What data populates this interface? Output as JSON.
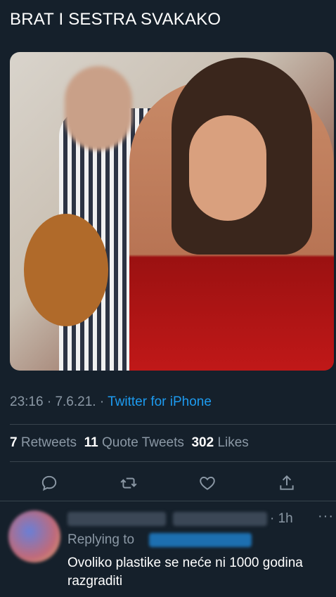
{
  "tweet": {
    "text": "BRAT I SESTRA SVAKAKO",
    "time": "23:16",
    "separator1": " · ",
    "date": "7.6.21.",
    "separator2": " · ",
    "source": "Twitter for iPhone"
  },
  "stats": {
    "retweets_count": "7",
    "retweets_label": "Retweets",
    "quotes_count": "11",
    "quotes_label": "Quote Tweets",
    "likes_count": "302",
    "likes_label": "Likes"
  },
  "actions": {
    "reply_icon": "reply-icon",
    "retweet_icon": "retweet-icon",
    "like_icon": "heart-icon",
    "share_icon": "share-icon"
  },
  "reply": {
    "time": "· 1h",
    "more": "···",
    "replying_to_label": "Replying to",
    "text": "Ovoliko plastike se neće ni 1000 godina razgraditi"
  },
  "colors": {
    "background": "#15202b",
    "link": "#1d9bf0",
    "muted": "#8b98a5",
    "divider": "#38444d"
  }
}
